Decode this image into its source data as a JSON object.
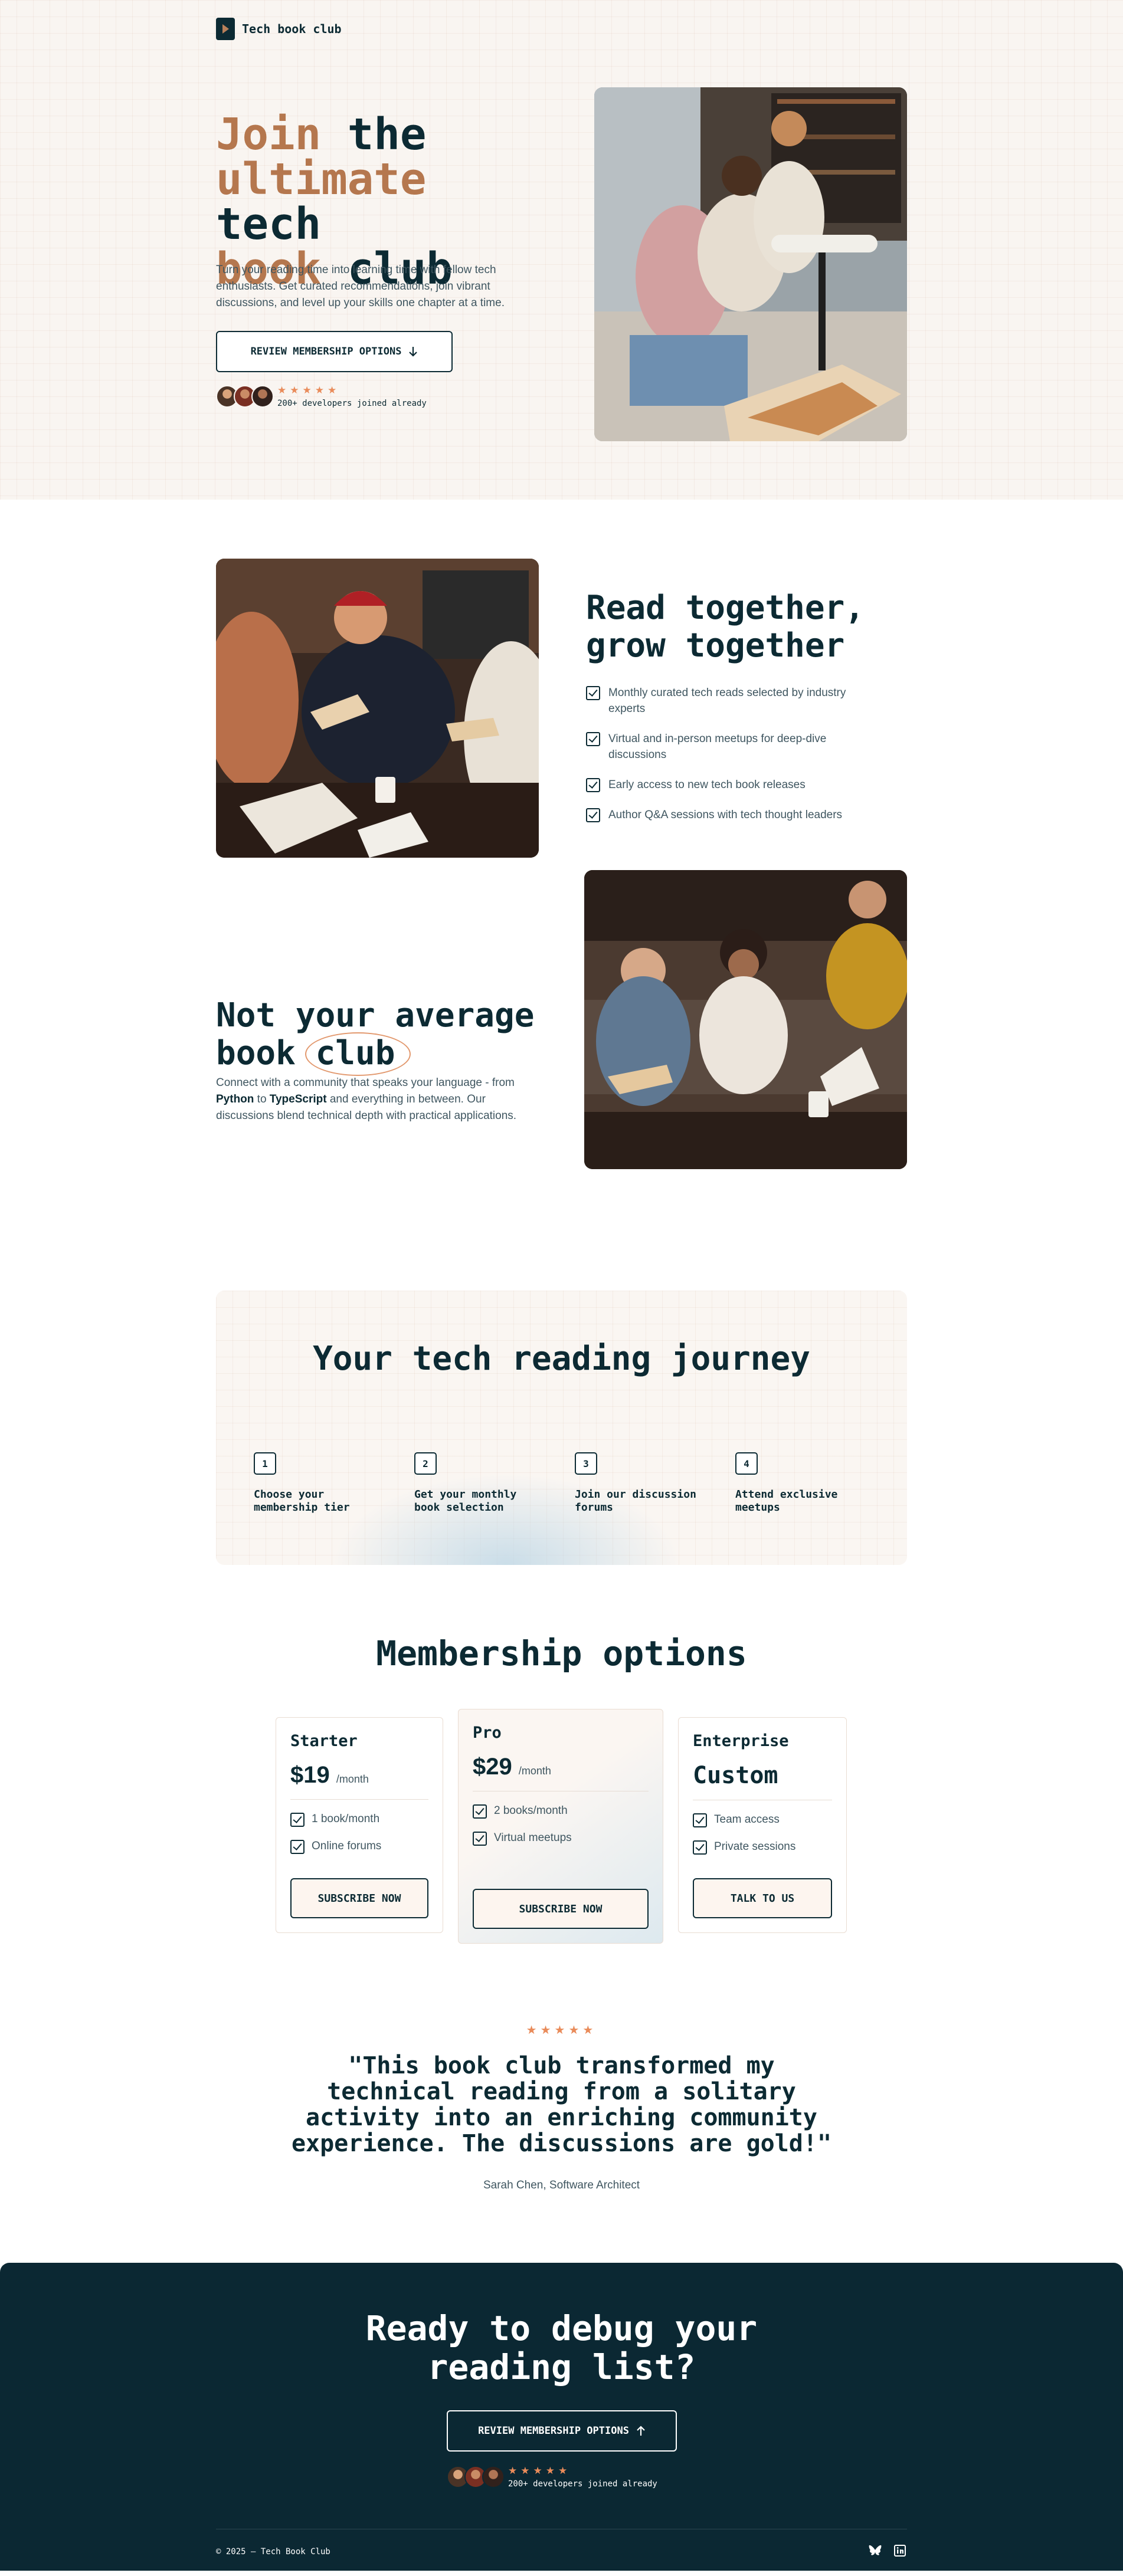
{
  "brand": {
    "name": "Tech book club"
  },
  "hero": {
    "title_accent_1": "Join",
    "title_1": " the",
    "title_accent_2": "ultimate",
    "title_2": " tech",
    "title_accent_3": "book",
    "title_3": " club",
    "subtitle": "Turn your reading time into learning time with fellow tech enthusiasts. Get curated recommendations, join vibrant discussions, and level up your skills one chapter at a time.",
    "cta_label": "REVIEW MEMBERSHIP OPTIONS",
    "cta_icon": "arrow-down-icon",
    "stars": "★★★★★",
    "social_proof": "200+ developers joined already"
  },
  "features": {
    "title": "Read together, grow together",
    "items": [
      "Monthly curated tech reads selected by industry experts",
      "Virtual and in-person meetups for deep-dive discussions",
      "Early access to new tech book releases",
      "Author Q&A sessions with tech thought leaders"
    ]
  },
  "average": {
    "title_1": "Not your average",
    "title_2a": "book ",
    "title_2b": "club",
    "text_1": "Connect with a community that speaks your language - from ",
    "text_python": "Python",
    "text_2": " to ",
    "text_ts": "TypeScript",
    "text_3": " and everything in between. Our discussions blend technical depth with practical applications."
  },
  "journey": {
    "title": "Your tech reading journey",
    "steps": [
      {
        "num": "1",
        "label": "Choose your membership tier"
      },
      {
        "num": "2",
        "label": "Get your monthly book selection"
      },
      {
        "num": "3",
        "label": "Join our discussion forums"
      },
      {
        "num": "4",
        "label": "Attend exclusive meetups"
      }
    ]
  },
  "pricing": {
    "title": "Membership options",
    "plans": [
      {
        "name": "Starter",
        "price": "$19",
        "period": "/month",
        "features": [
          "1 book/month",
          "Online forums"
        ],
        "button": "SUBSCRIBE NOW"
      },
      {
        "name": "Pro",
        "price": "$29",
        "period": "/month",
        "features": [
          "2 books/month",
          "Virtual meetups"
        ],
        "button": "SUBSCRIBE NOW"
      },
      {
        "name": "Enterprise",
        "price": "Custom",
        "period": "",
        "features": [
          "Team access",
          "Private sessions"
        ],
        "button": "TALK TO US"
      }
    ]
  },
  "testimonial": {
    "stars": "★★★★★",
    "quote": "\"This book club transformed my technical reading from a solitary activity into an enriching community experience. The discussions are gold!\"",
    "author": "Sarah Chen, Software Architect"
  },
  "cta": {
    "title": "Ready to debug your reading list?",
    "button": "REVIEW MEMBERSHIP OPTIONS",
    "button_icon": "arrow-up-icon",
    "stars": "★★★★★",
    "social_proof": "200+ developers joined already"
  },
  "footer": {
    "copyright": "© 2025 — Tech Book Club",
    "icons": [
      "bluesky-icon",
      "linkedin-icon"
    ]
  },
  "colors": {
    "dark": "#0c2a33",
    "accent": "#b5774e",
    "star": "#e98b5a",
    "cream": "#f9f5f1"
  }
}
